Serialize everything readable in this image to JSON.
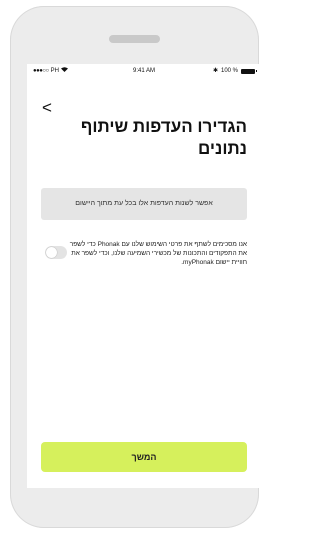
{
  "status_bar": {
    "carrier": "PH",
    "time": "9:41 AM",
    "battery": "100 %"
  },
  "header": {
    "back_label": "<",
    "title": "הגדירו העדפות שיתוף נתונים"
  },
  "info": {
    "text": "אפשר לשנות העדפות אלו בכל עת מתוך היישום"
  },
  "consent": {
    "text": "אנו מסכימים לשתף את פרטי השימוש שלנו עם Phonak כדי לשפר את התפקודים והתכונות של מכשירי השמיעה שלנו, וכדי לשפר את חוויית יישום myPhonak.",
    "toggle_on": false
  },
  "footer": {
    "continue_label": "המשך"
  },
  "colors": {
    "accent": "#d6f05c",
    "info_bg": "#e5e5e5",
    "device": "#ececec"
  }
}
